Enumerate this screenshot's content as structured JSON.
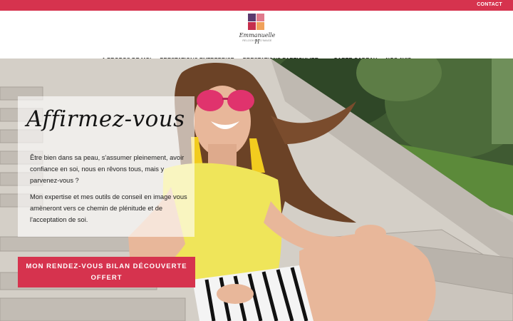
{
  "topbar": {
    "contact_label": "CONTACT"
  },
  "logo": {
    "script_text": "Emmanuelle H",
    "tagline": "RELOOKING D'IMAGE",
    "colors": [
      "#5b3a6e",
      "#e07a8c",
      "#c62f4d",
      "#f0a15a"
    ]
  },
  "nav": {
    "items": [
      {
        "label": "A PROPOS DE MOI"
      },
      {
        "label": "PRESTATIONS ENTREPRISE"
      },
      {
        "label": "PRESTATIONS PARTICULIER",
        "has_dropdown": true,
        "icon": "chevron-down-icon"
      },
      {
        "label": "CARTE CADEAU"
      },
      {
        "label": "NOS AVIS"
      }
    ]
  },
  "hero": {
    "title": "Affirmez-vous",
    "paragraph1": "Être bien dans sa peau, s'assumer pleinement, avoir confiance en soi, nous en rêvons tous, mais y parvenez-vous ?",
    "paragraph2": "Mon expertise et mes outils de conseil en image vous amèneront vers ce chemin de plénitude et de l'acceptation de soi.",
    "cta_label": "MON RENDEZ-VOUS BILAN DÉCOUVERTE OFFERT"
  },
  "colors": {
    "accent": "#d6334e",
    "nav_text": "#222222"
  }
}
